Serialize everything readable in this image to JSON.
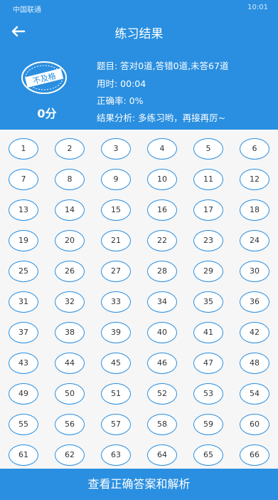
{
  "status_bar": {
    "carrier": "中国联通",
    "time": "10:01",
    "icons": [
      "signal-icon",
      "wifi-icon",
      "settings-icon",
      "alarm-icon",
      "bluetooth-icon",
      "vibrate-icon",
      "battery-icon"
    ]
  },
  "header": {
    "back_icon": "arrow-left-icon",
    "title": "练习结果",
    "stamp_text": "不及格",
    "score": "0分",
    "info_lines": [
      "题目: 答对0道,答错0道,未答67道",
      "用时: 00:04",
      "正确率: 0%",
      "结果分析: 多练习哟，再接再厉~"
    ]
  },
  "questions": [
    "1",
    "2",
    "3",
    "4",
    "5",
    "6",
    "7",
    "8",
    "9",
    "10",
    "11",
    "12",
    "13",
    "14",
    "15",
    "16",
    "17",
    "18",
    "19",
    "20",
    "21",
    "22",
    "23",
    "24",
    "25",
    "26",
    "27",
    "28",
    "29",
    "30",
    "31",
    "32",
    "33",
    "34",
    "35",
    "36",
    "37",
    "38",
    "39",
    "40",
    "41",
    "42",
    "43",
    "44",
    "45",
    "46",
    "47",
    "48",
    "49",
    "50",
    "51",
    "52",
    "53",
    "54",
    "55",
    "56",
    "57",
    "58",
    "59",
    "60",
    "61",
    "62",
    "63",
    "64",
    "65",
    "66"
  ],
  "footer": {
    "button_label": "查看正确答案和解析"
  },
  "colors": {
    "primary": "#2a8fe0",
    "grid_bg": "#f6f6f6"
  }
}
